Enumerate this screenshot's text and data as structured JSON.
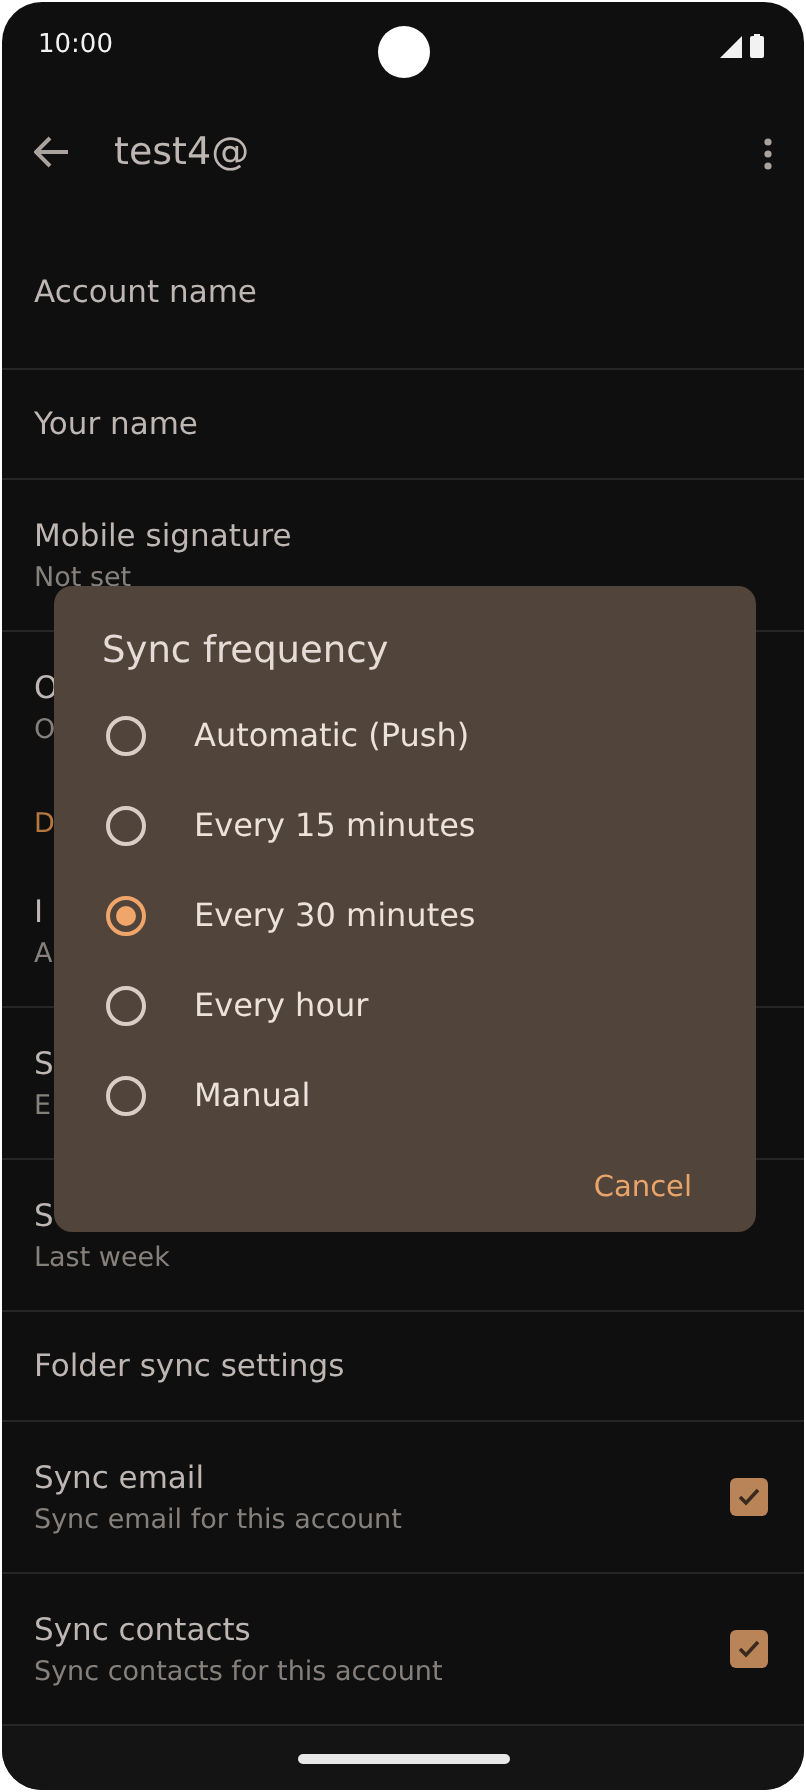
{
  "status_bar": {
    "time": "10:00"
  },
  "app_bar": {
    "title": "test4@"
  },
  "settings": [
    {
      "kind": "item",
      "title": "Account name"
    },
    {
      "kind": "item",
      "title": "Your name"
    },
    {
      "kind": "item",
      "title": "Mobile signature",
      "summary": "Not set"
    },
    {
      "kind": "item",
      "title": "O",
      "summary": "O",
      "divider": false
    },
    {
      "kind": "header",
      "title": "D"
    },
    {
      "kind": "item",
      "title": "I",
      "summary": "A"
    },
    {
      "kind": "item",
      "title": "S",
      "summary": "E"
    },
    {
      "kind": "item",
      "title": "S",
      "summary": "Last week"
    },
    {
      "kind": "item",
      "title": "Folder sync settings"
    },
    {
      "kind": "checkbox",
      "title": "Sync email",
      "summary": "Sync email for this account",
      "checked": true
    },
    {
      "kind": "checkbox",
      "title": "Sync contacts",
      "summary": "Sync contacts for this account",
      "checked": true
    }
  ],
  "dialog": {
    "title": "Sync frequency",
    "options": [
      {
        "label": "Automatic (Push)",
        "selected": false
      },
      {
        "label": "Every 15 minutes",
        "selected": false
      },
      {
        "label": "Every 30 minutes",
        "selected": true
      },
      {
        "label": "Every hour",
        "selected": false
      },
      {
        "label": "Manual",
        "selected": false
      }
    ],
    "buttons": [
      "Cancel"
    ]
  }
}
